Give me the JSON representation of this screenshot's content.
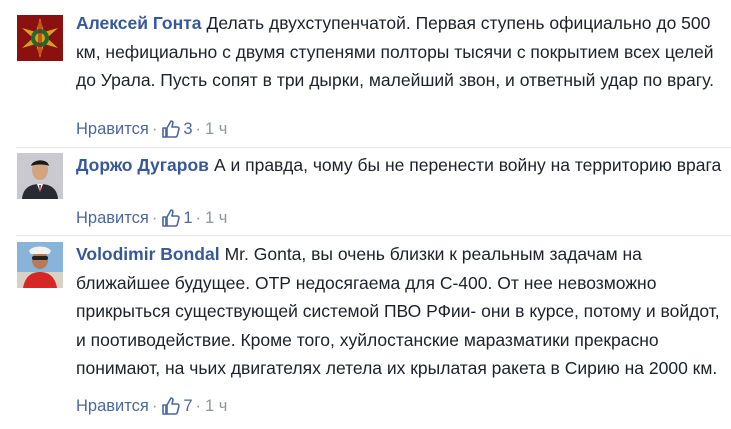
{
  "comments": [
    {
      "author": "Алексей Гонта",
      "text": "Делать двухступенчатой. Первая ступень официально до 500 км, нефициально с двумя ступенями полторы тысячи с покрытием всех целей до Урала. Пусть сопят в три дырки, малейший звон, и ответный удар по врагу.",
      "like_label": "Нравится",
      "likes": "3",
      "time": "1 ч"
    },
    {
      "author": "Доржо Дугаров",
      "text": "А и правда, чому бы не перенести войну на территорию врага",
      "like_label": "Нравится",
      "likes": "1",
      "time": "1 ч"
    },
    {
      "author": "Volodimir Bondal",
      "text": "Mr. Gonta, вы очень близки к реальным задачам на ближайшее будущее. ОТР недосягаема для С-400. От нее невозможно прикрыться существующей системой ПВО РФии- они в курсе, потому и войдот, и поотиводействие. Кроме того, хуйлостанские маразматики прекрасно понимают, на чьих двигателях летела их крылатая ракета в Сирию на 2000 км.",
      "like_label": "Нравится",
      "likes": "7",
      "time": "1 ч"
    }
  ],
  "separator": "·",
  "colors": {
    "author_link": "#365899",
    "like_link": "#4b67a1",
    "meta": "#90949c",
    "text": "#1d2129"
  },
  "icons": {
    "like": "thumbs-up-icon"
  }
}
